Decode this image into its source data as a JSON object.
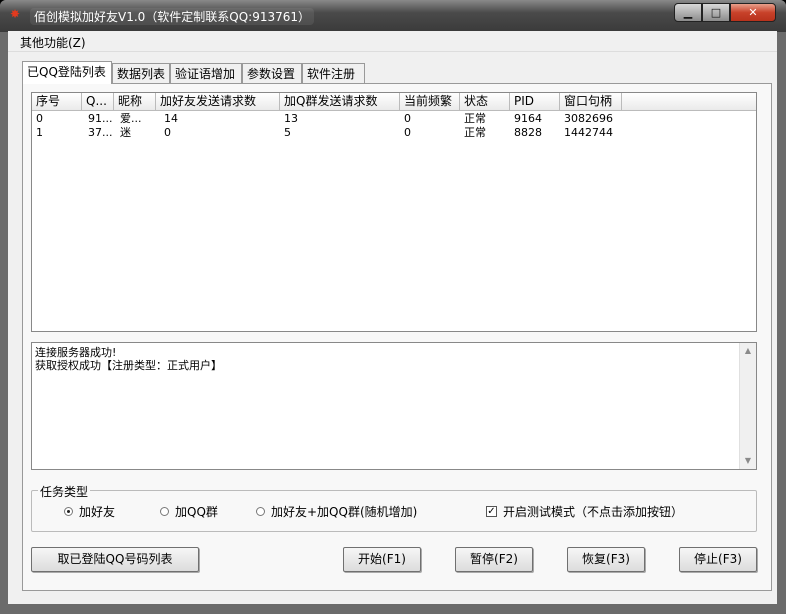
{
  "window": {
    "title": "佰创模拟加好友V1.0（软件定制联系QQ:913761）",
    "controls": [
      "minimize",
      "maximize",
      "close"
    ]
  },
  "menu": {
    "other_functions": "其他功能(Z)"
  },
  "tabs": [
    {
      "label": "已QQ登陆列表",
      "active": true
    },
    {
      "label": "数据列表",
      "active": false
    },
    {
      "label": "验证语增加",
      "active": false
    },
    {
      "label": "参数设置",
      "active": false
    },
    {
      "label": "软件注册",
      "active": false
    }
  ],
  "table": {
    "headers": [
      "序号",
      "Q...",
      "昵称",
      "加好友发送请求数",
      "加Q群发送请求数",
      "当前频繁",
      "状态",
      "PID",
      "窗口句柄"
    ],
    "rows": [
      [
        "0",
        "91...",
        "爱...",
        "14",
        "13",
        "0",
        "正常",
        "9164",
        "3082696"
      ],
      [
        "1",
        "37...",
        "迷",
        "0",
        "5",
        "0",
        "正常",
        "8828",
        "1442744"
      ]
    ]
  },
  "log": {
    "lines": [
      "连接服务器成功!",
      "获取授权成功【注册类型：正式用户】"
    ]
  },
  "task_type": {
    "title": "任务类型",
    "options": [
      {
        "label": "加好友",
        "selected": true
      },
      {
        "label": "加QQ群",
        "selected": false
      },
      {
        "label": "加好友+加QQ群(随机增加)",
        "selected": false
      }
    ],
    "test_mode": {
      "label": "开启测试模式（不点击添加按钮）",
      "checked": true
    }
  },
  "buttons": {
    "fetch_list": "取已登陆QQ号码列表",
    "start": "开始(F1)",
    "pause": "暂停(F2)",
    "resume": "恢复(F3)",
    "stop": "停止(F3)"
  },
  "colors": {
    "titlebar": "#3a3a3a",
    "close_button": "#c8422a",
    "client_bg": "#f0f0f0"
  }
}
